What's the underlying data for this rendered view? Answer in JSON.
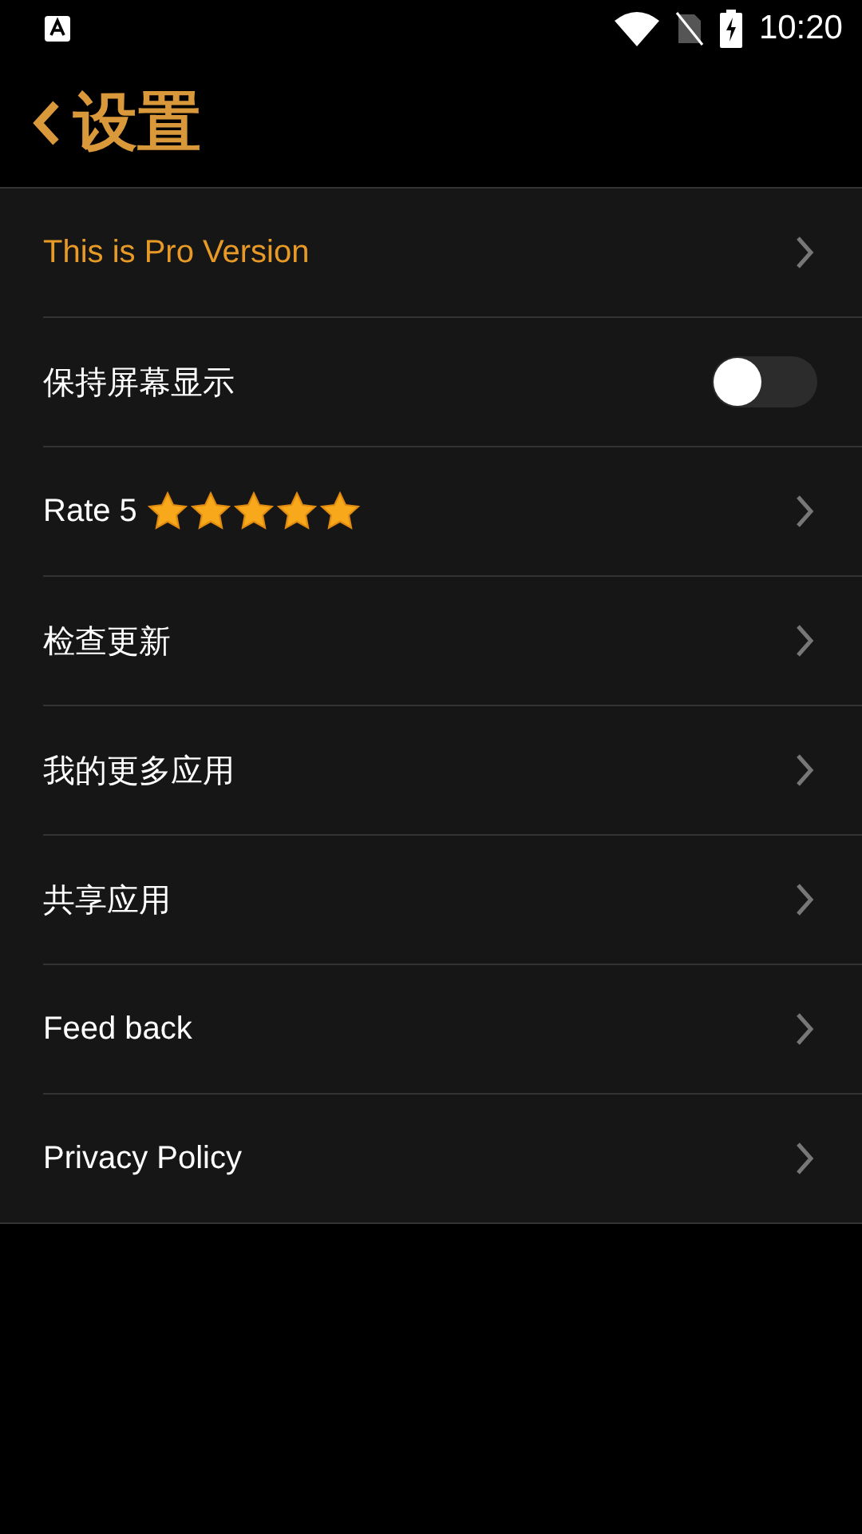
{
  "status_bar": {
    "time": "10:20"
  },
  "header": {
    "title": "设置"
  },
  "rows": [
    {
      "kind": "link",
      "label": "This is Pro Version",
      "highlighted": true
    },
    {
      "kind": "toggle",
      "label": "保持屏幕显示",
      "highlighted": false,
      "on": false
    },
    {
      "kind": "rating",
      "label": "Rate 5",
      "highlighted": false,
      "stars": 5
    },
    {
      "kind": "link",
      "label": "检查更新",
      "highlighted": false
    },
    {
      "kind": "link",
      "label": "我的更多应用",
      "highlighted": false
    },
    {
      "kind": "link",
      "label": "共享应用",
      "highlighted": false
    },
    {
      "kind": "link",
      "label": "Feed back",
      "highlighted": false
    },
    {
      "kind": "link",
      "label": "Privacy Policy",
      "highlighted": false
    }
  ]
}
